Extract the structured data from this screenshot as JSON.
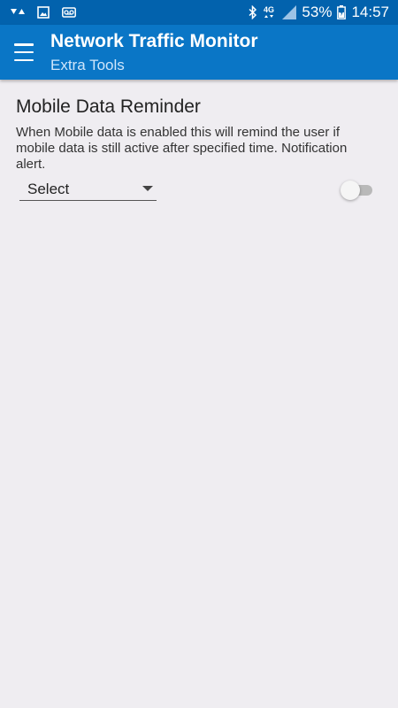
{
  "status_bar": {
    "left_icons": [
      "signal-down-up-icon",
      "image-icon",
      "voicemail-icon"
    ],
    "right_icons": [
      "bluetooth-icon",
      "network-4g-icon",
      "cell-signal-icon",
      "battery-icon"
    ],
    "network_type": "4G",
    "battery_percent": "53%",
    "time": "14:57"
  },
  "app_bar": {
    "title": "Network Traffic Monitor",
    "subtitle": "Extra Tools",
    "menu_icon": "hamburger-menu-icon",
    "background_color": "#0a76c6",
    "status_bar_color": "#0262ad"
  },
  "mobile_data_reminder": {
    "title": "Mobile Data Reminder",
    "description": "When Mobile data is enabled this will remind the user if mobile data is still active after specified time. Notification alert.",
    "select": {
      "selected_value": "Select"
    },
    "toggle": {
      "enabled": false
    }
  },
  "colors": {
    "page_background": "#efedf1",
    "text_primary": "#222222"
  }
}
